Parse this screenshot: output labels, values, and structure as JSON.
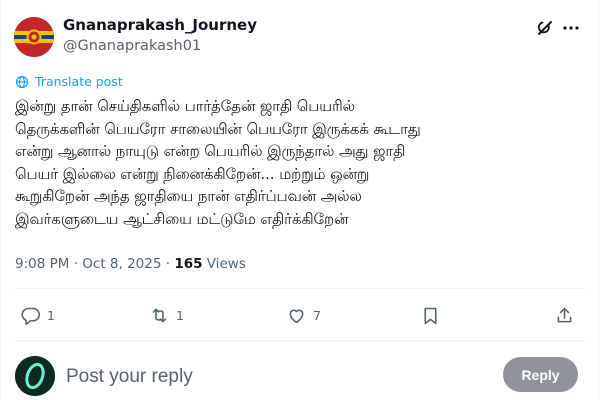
{
  "author": {
    "name": "Gnanaprakash_Journey",
    "handle": "@Gnanaprakash01",
    "avatar_icon": "flag-avatar-icon",
    "avatar_color": "#c3262d"
  },
  "header_icons": {
    "grok": "grok-icon",
    "more": "more-dots-icon"
  },
  "translate_label": "Translate post",
  "tweet_text": "இன்று தான் செய்திகளில் பார்த்தேன் ஜாதி பெயரில்\nதெருக்களின் பெயரோ சாலையின் பெயரோ இருக்கக் கூடாது\nஎன்று ஆனால் நாயுடு என்ற பெயரில் இருந்தால் அது ஜாதி\nபெயர் இல்லை என்று நினைக்கிறேன்... மற்றும் ஒன்று\nகூறுகிறேன் அந்த ஜாதியை நான் எதிர்ப்பவன் அல்ல\nஇவர்களுடைய ஆட்சியை மட்டுமே எதிர்க்கிறேன்",
  "meta": {
    "time": "9:08 PM",
    "separator": " · ",
    "date": "Oct 8, 2025",
    "views_count": "165",
    "views_label": " Views"
  },
  "actions": {
    "reply_count": "1",
    "repost_count": "1",
    "like_count": "7"
  },
  "reply_box": {
    "placeholder": "Post your reply",
    "button_label": "Reply",
    "button_color": "#8e9499"
  },
  "colors": {
    "accent": "#1d9bf0",
    "muted": "#536471",
    "text": "#0f1419"
  }
}
